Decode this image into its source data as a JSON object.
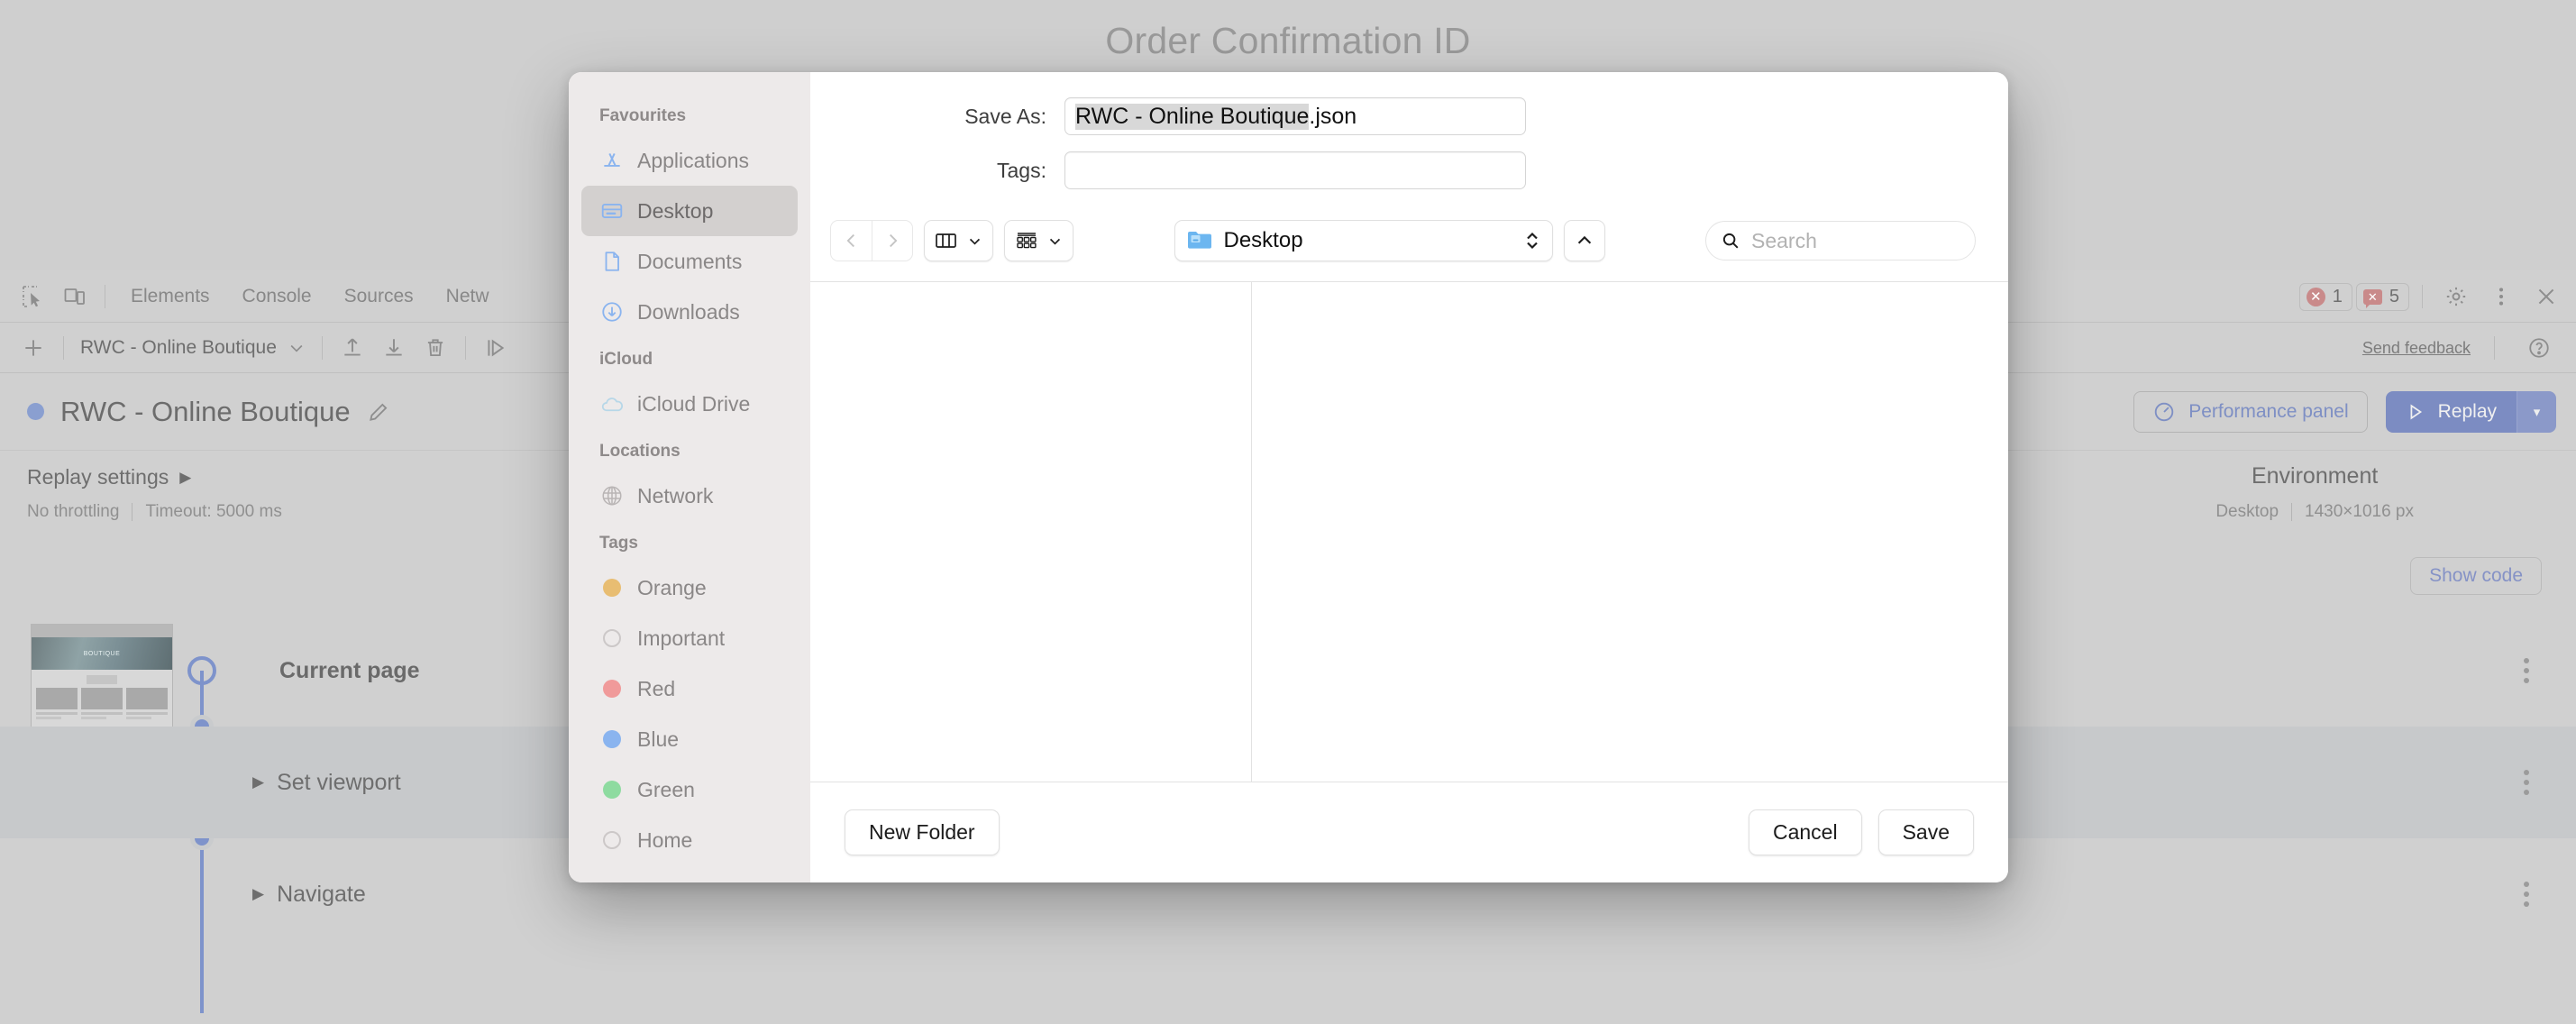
{
  "page": {
    "title": "Order Confirmation ID"
  },
  "devtools": {
    "icons": {
      "inspect": "inspect-element-icon",
      "device": "device-toolbar-icon"
    },
    "tabs": [
      {
        "label": "Elements"
      },
      {
        "label": "Console"
      },
      {
        "label": "Sources"
      },
      {
        "label": "Netw"
      }
    ],
    "status": {
      "errors": "1",
      "warnings": "5"
    },
    "right_icons": {
      "settings": "gear-icon",
      "more": "more-vertical-icon",
      "close": "close-icon"
    },
    "recorder_toolbar": {
      "add_label": "+",
      "recording_name": "RWC - Online Boutique",
      "import_label": "import-icon",
      "export_label": "export-icon",
      "delete_label": "delete-icon",
      "replay_label": "continue-icon",
      "send_feedback": "Send feedback",
      "help": "?"
    }
  },
  "recorder": {
    "title": "RWC - Online Boutique",
    "edit_icon": "pencil-icon",
    "performance_panel_label": "Performance panel",
    "replay_label": "Replay",
    "replay_caret": "▾",
    "replay_settings_label": "Replay settings",
    "replay_settings_caret": "▶",
    "throttling": "No throttling",
    "timeout": "Timeout: 5000 ms",
    "environment_title": "Environment",
    "environment_device": "Desktop",
    "environment_size": "1430×1016 px",
    "show_code_label": "Show code",
    "steps": [
      {
        "label": "Current page",
        "expandable": false
      },
      {
        "label": "Set viewport",
        "expandable": true,
        "caret": "▶"
      },
      {
        "label": "Navigate",
        "expandable": true,
        "caret": "▶"
      }
    ],
    "thumbnail_text": "BOUTIQUE"
  },
  "dialog": {
    "save_as_label": "Save As:",
    "filename_base": "RWC - Online Boutique",
    "filename_ext": ".json",
    "tags_label": "Tags:",
    "tags_value": "",
    "toolbar": {
      "back": "‹",
      "forward": "›",
      "view_columns_icon": "column-view-icon",
      "view_chevron": "▾",
      "group_icon": "group-by-icon",
      "group_chevron": "▾",
      "path_value": "Desktop",
      "path_stepper": "up-down-chevron-icon",
      "up_button": "^",
      "search_placeholder": "Search"
    },
    "sidebar": {
      "sections": [
        {
          "title": "Favourites",
          "items": [
            {
              "label": "Applications",
              "icon": "applications-icon",
              "selected": false
            },
            {
              "label": "Desktop",
              "icon": "desktop-icon",
              "selected": true
            },
            {
              "label": "Documents",
              "icon": "documents-icon",
              "selected": false
            },
            {
              "label": "Downloads",
              "icon": "downloads-icon",
              "selected": false
            }
          ]
        },
        {
          "title": "iCloud",
          "items": [
            {
              "label": "iCloud Drive",
              "icon": "icloud-icon",
              "selected": false
            }
          ]
        },
        {
          "title": "Locations",
          "items": [
            {
              "label": "Network",
              "icon": "network-icon",
              "selected": false
            }
          ]
        },
        {
          "title": "Tags",
          "items": [
            {
              "label": "Orange",
              "icon": "tag-dot",
              "color": "#e8bd72",
              "selected": false
            },
            {
              "label": "Important",
              "icon": "tag-dot",
              "color": "transparent",
              "selected": false
            },
            {
              "label": "Red",
              "icon": "tag-dot",
              "color": "#f09a9a",
              "selected": false
            },
            {
              "label": "Blue",
              "icon": "tag-dot",
              "color": "#8ab4ef",
              "selected": false
            },
            {
              "label": "Green",
              "icon": "tag-dot",
              "color": "#8edba0",
              "selected": false
            },
            {
              "label": "Home",
              "icon": "tag-dot",
              "color": "transparent",
              "selected": false
            }
          ]
        }
      ]
    },
    "footer": {
      "new_folder_label": "New Folder",
      "cancel_label": "Cancel",
      "save_label": "Save"
    }
  },
  "colors": {
    "accent_blue": "#7e93cb",
    "dialog_sidebar": "#edeaea",
    "selection_gray": "#d8d8d8",
    "devtools_bg": "#d0d0d0"
  }
}
